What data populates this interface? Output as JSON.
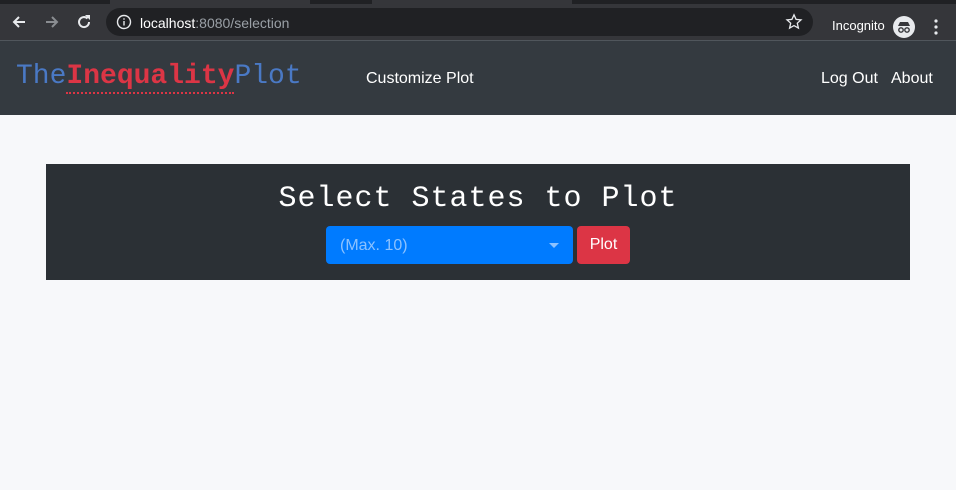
{
  "browser": {
    "url_host": "localhost",
    "url_rest": ":8080/selection",
    "incognito_label": "Incognito"
  },
  "navbar": {
    "brand": {
      "part1": "The",
      "part2": "Inequality",
      "part3": "Plot"
    },
    "customize_label": "Customize Plot",
    "logout_label": "Log Out",
    "about_label": "About"
  },
  "panel": {
    "title": "Select States to Plot",
    "select_placeholder": "(Max. 10)",
    "plot_button": "Plot"
  },
  "colors": {
    "navbar_bg": "#343a40",
    "brand_blue": "#4a79c5",
    "brand_red": "#dc3545",
    "select_bg": "#007bff",
    "plot_button_bg": "#dc3545"
  }
}
